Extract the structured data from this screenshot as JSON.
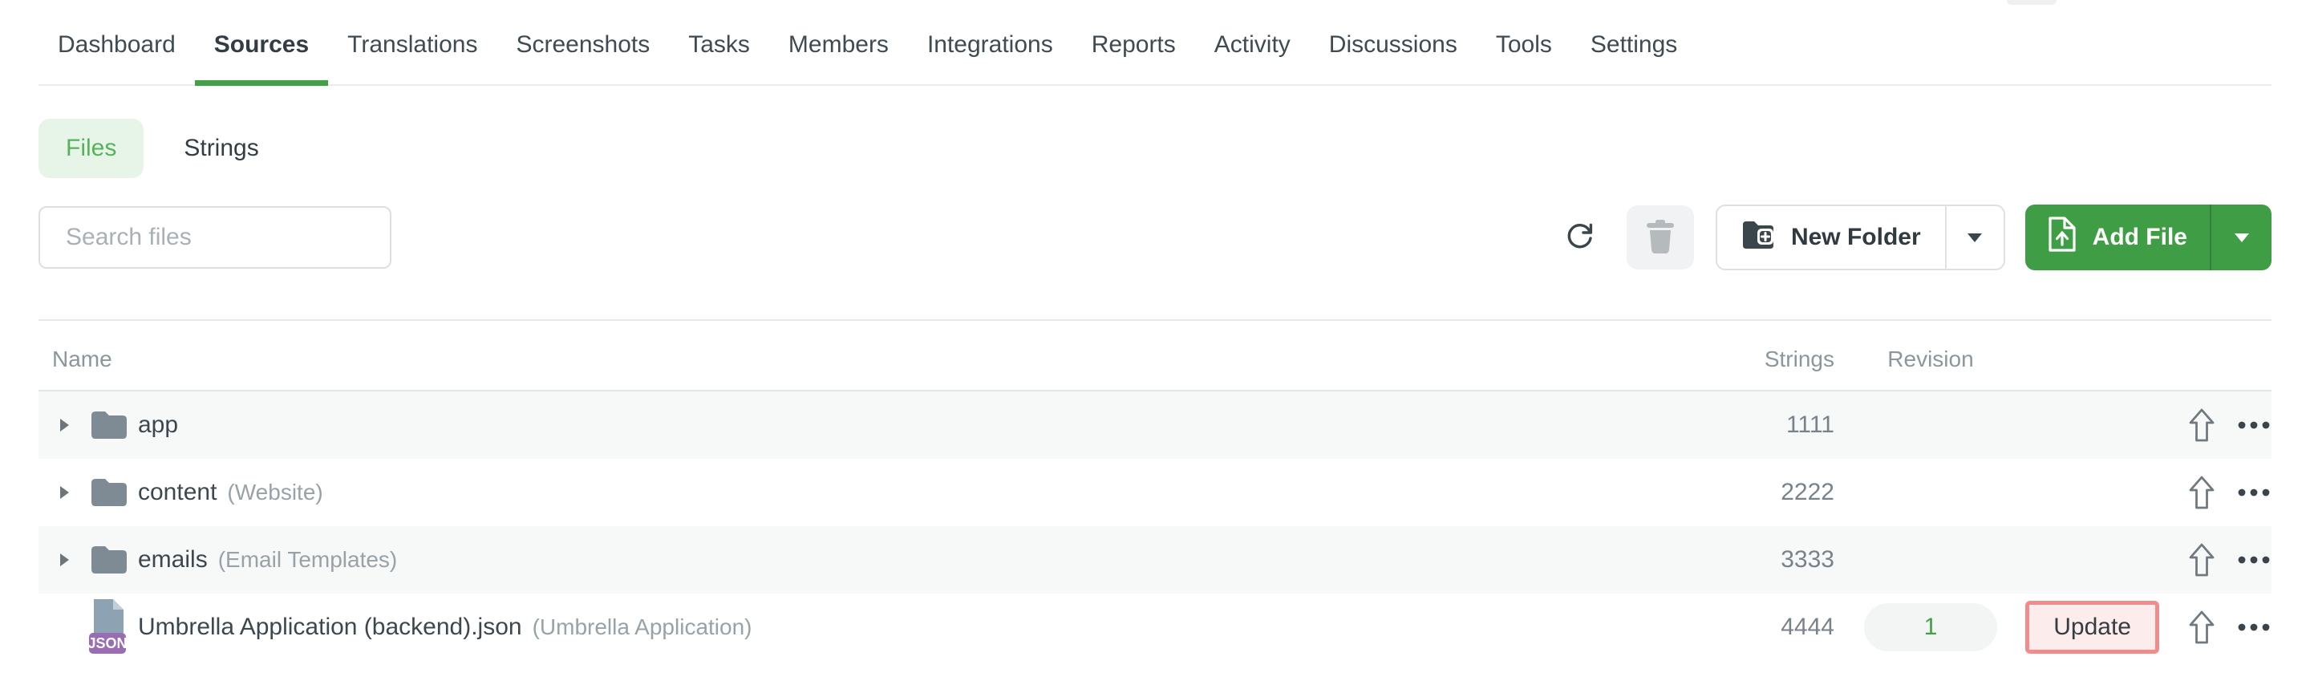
{
  "nav": {
    "tabs": [
      {
        "label": "Dashboard",
        "active": false
      },
      {
        "label": "Sources",
        "active": true
      },
      {
        "label": "Translations",
        "active": false
      },
      {
        "label": "Screenshots",
        "active": false
      },
      {
        "label": "Tasks",
        "active": false
      },
      {
        "label": "Members",
        "active": false
      },
      {
        "label": "Integrations",
        "active": false
      },
      {
        "label": "Reports",
        "active": false
      },
      {
        "label": "Activity",
        "active": false
      },
      {
        "label": "Discussions",
        "active": false
      },
      {
        "label": "Tools",
        "active": false
      },
      {
        "label": "Settings",
        "active": false
      }
    ]
  },
  "view_toggle": {
    "files_label": "Files",
    "strings_label": "Strings",
    "active": "Files"
  },
  "toolbar": {
    "search_placeholder": "Search files",
    "new_folder_label": "New Folder",
    "add_file_label": "Add File"
  },
  "table": {
    "headers": {
      "name": "Name",
      "strings": "Strings",
      "revision": "Revision"
    },
    "rows": [
      {
        "type": "folder",
        "name": "app",
        "secondary": "",
        "strings": "1111",
        "revision": "",
        "update": ""
      },
      {
        "type": "folder",
        "name": "content",
        "secondary": "(Website)",
        "strings": "2222",
        "revision": "",
        "update": ""
      },
      {
        "type": "folder",
        "name": "emails",
        "secondary": "(Email Templates)",
        "strings": "3333",
        "revision": "",
        "update": ""
      },
      {
        "type": "file",
        "badge": "JSON",
        "name": "Umbrella Application (backend).json",
        "secondary": "(Umbrella Application)",
        "strings": "4444",
        "revision": "1",
        "update": "Update"
      }
    ]
  },
  "colors": {
    "accent_green": "#3f9e45",
    "underline_green": "#43a047",
    "files_pill_bg": "#e7f4e8",
    "files_text": "#57b25e",
    "revision_text": "#43a047",
    "update_bg": "#fdecec",
    "update_border": "#f08c8c",
    "json_badge": "#9a6cb4",
    "row_alt_bg": "#f7f8f8"
  }
}
